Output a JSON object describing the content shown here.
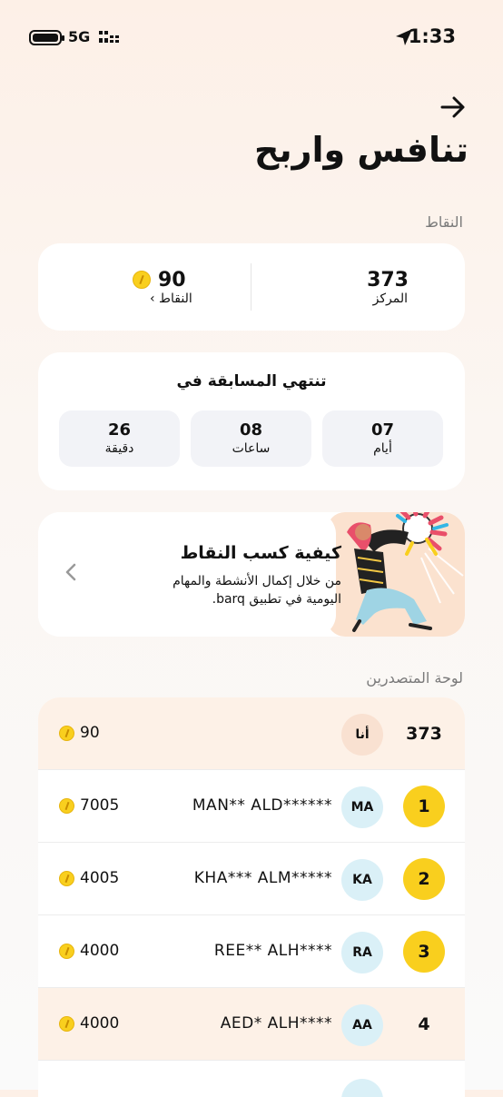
{
  "status_bar": {
    "time": "1:33",
    "network": "5G",
    "icons": [
      "location-arrow-icon",
      "signal-icon",
      "battery-icon"
    ]
  },
  "header": {
    "back_icon": "arrow-right-icon",
    "title": "تنافس واربح"
  },
  "points_section": {
    "label": "النقاط",
    "rank_value": "373",
    "rank_label": "المركز",
    "points_value": "90",
    "points_link": "النقاط ›"
  },
  "timer": {
    "title": "تنتهي المسابقة في",
    "boxes": [
      {
        "value": "07",
        "label": "أيام"
      },
      {
        "value": "08",
        "label": "ساعات"
      },
      {
        "value": "26",
        "label": "دقيقة"
      }
    ]
  },
  "how_to": {
    "title": "كيفية كسب النقاط",
    "description": "من خلال إكمال الأنشطة والمهام اليومية في تطبيق barq."
  },
  "leaderboard": {
    "label": "لوحة المتصدرين",
    "rows": [
      {
        "rank": "373",
        "initials": "أنا",
        "name": "",
        "points": "90",
        "me": true,
        "medal": false
      },
      {
        "rank": "1",
        "initials": "MA",
        "name": "MAN** ALD******",
        "points": "7005",
        "me": false,
        "medal": true
      },
      {
        "rank": "2",
        "initials": "KA",
        "name": "KHA*** ALM*****",
        "points": "4005",
        "me": false,
        "medal": true
      },
      {
        "rank": "3",
        "initials": "RA",
        "name": "REE** ALH****",
        "points": "4000",
        "me": false,
        "medal": true
      },
      {
        "rank": "4",
        "initials": "AA",
        "name": "AED* ALH****",
        "points": "4000",
        "me": true,
        "medal": false
      }
    ]
  },
  "colors": {
    "accent_gold": "#f9cf1e",
    "me_row_bg": "#fdf1e7",
    "avatar_bg": "#daf0f7",
    "illustration_bg": "#fbe2cf"
  }
}
